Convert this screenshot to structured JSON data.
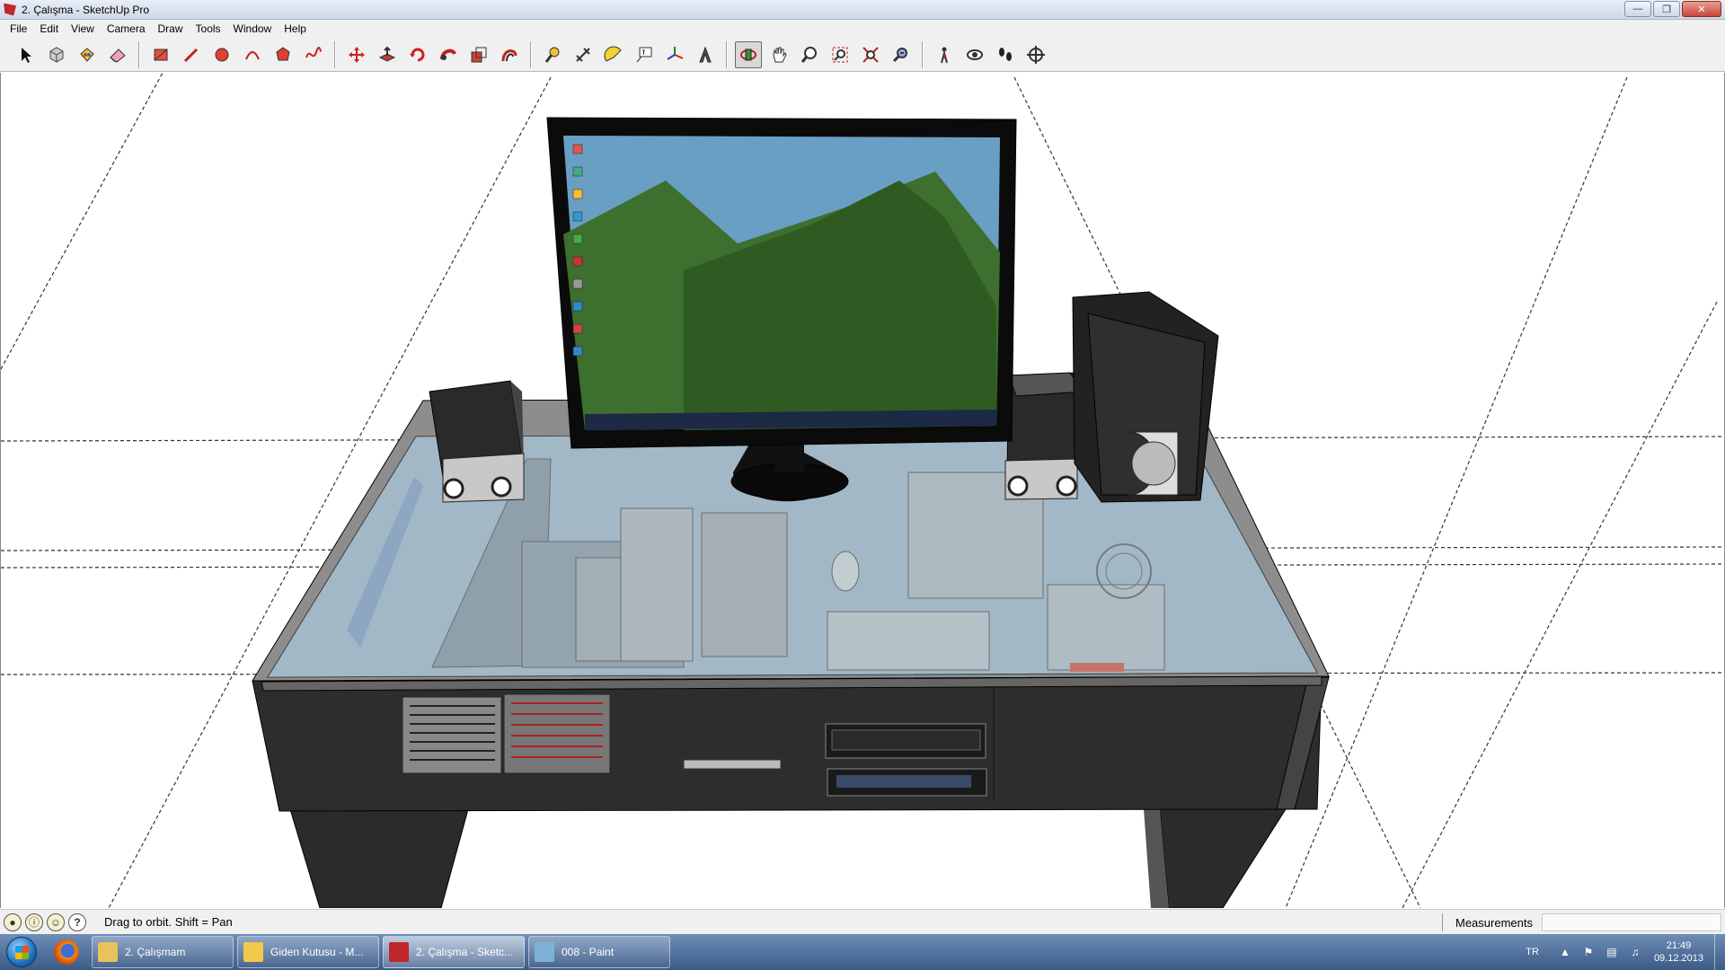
{
  "window": {
    "title": "2. Çalışma - SketchUp Pro",
    "buttons": [
      "minimize",
      "maximize",
      "close"
    ]
  },
  "menu": [
    "File",
    "Edit",
    "View",
    "Camera",
    "Draw",
    "Tools",
    "Window",
    "Help"
  ],
  "toolbar": {
    "groups": [
      [
        "select-icon",
        "make-component-icon",
        "paint-bucket-icon",
        "eraser-icon"
      ],
      [
        "rectangle-icon",
        "line-icon",
        "circle-icon",
        "arc-icon",
        "polygon-icon",
        "freehand-icon"
      ],
      [
        "move-icon",
        "push-pull-icon",
        "rotate-icon",
        "follow-me-icon",
        "scale-icon",
        "offset-icon"
      ],
      [
        "tape-measure-icon",
        "dimension-icon",
        "protractor-icon",
        "text-icon",
        "axes-icon",
        "3d-text-icon"
      ],
      [
        "orbit-icon",
        "pan-icon",
        "zoom-icon",
        "zoom-window-icon",
        "zoom-extents-icon",
        "previous-view-icon"
      ],
      [
        "position-camera-icon",
        "look-around-icon",
        "walk-icon",
        "section-plane-icon"
      ]
    ],
    "active_tool": "orbit-icon"
  },
  "status": {
    "icons": [
      "geo-location-icon",
      "credits-icon",
      "sign-in-icon",
      "help-icon"
    ],
    "text": "Drag to orbit.  Shift = Pan",
    "measurements_label": "Measurements",
    "measurements_value": ""
  },
  "taskbar": {
    "tasks": [
      {
        "label": "2. Çalışmam",
        "icon": "folder-icon",
        "color": "#e8c25a",
        "active": false
      },
      {
        "label": "Giden Kutusu - M...",
        "icon": "outlook-icon",
        "color": "#f2c94c",
        "active": false
      },
      {
        "label": "2. Çalışma - Sketc...",
        "icon": "sketchup-icon",
        "color": "#c0272d",
        "active": true
      },
      {
        "label": "008 - Paint",
        "icon": "paint-icon",
        "color": "#7fb0d8",
        "active": false
      }
    ],
    "language": "TR",
    "time": "21:49",
    "date": "09.12.2013"
  }
}
